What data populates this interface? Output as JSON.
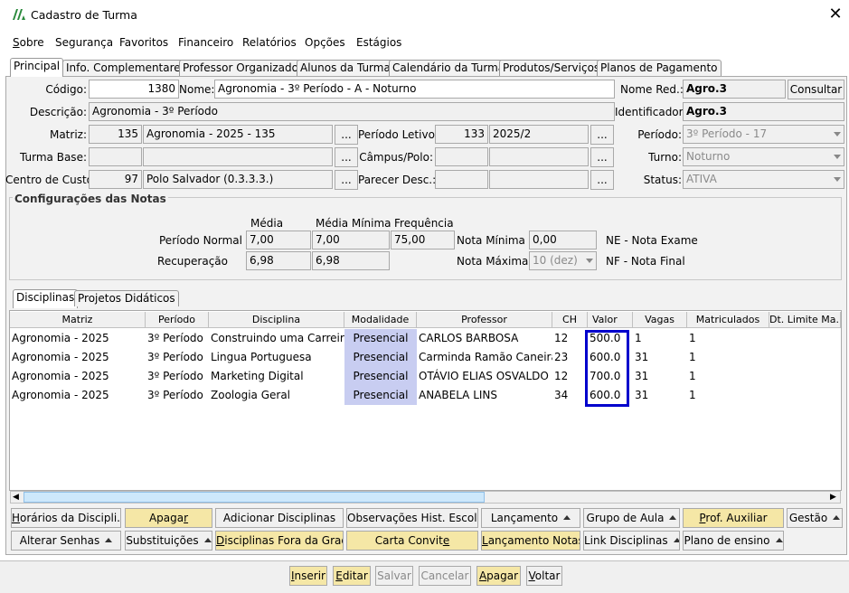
{
  "window": {
    "title": "Cadastro de Turma"
  },
  "menu": [
    "Sobre",
    "Segurança",
    "Favoritos",
    "Financeiro",
    "Relatórios",
    "Opções",
    "Estágios"
  ],
  "tabs": [
    "Principal",
    "Info. Complementares",
    "Professor Organizador",
    "Alunos da Turma",
    "Calendário da Turma",
    "Produtos/Serviços",
    "Planos de Pagamento"
  ],
  "form": {
    "codigo_label": "Código:",
    "codigo": "1380",
    "nome_label": "Nome:",
    "nome": "Agronomia - 3º Período - A - Noturno",
    "nome_red_label": "Nome Red.:",
    "nome_red": "Agro.3",
    "consultar": "Consultar",
    "descricao_label": "Descrição:",
    "descricao": "Agronomia - 3º Período",
    "identificador_label": "Identificador:",
    "identificador": "Agro.3",
    "matriz_label": "Matriz:",
    "matriz_cod": "135",
    "matriz_nome": "Agronomia - 2025 - 135",
    "periodo_letivo_label": "Período Letivo:",
    "periodo_letivo_cod": "133",
    "periodo_letivo": "2025/2",
    "periodo_label": "Período:",
    "periodo": "3º Período - 17",
    "turma_base_label": "Turma Base:",
    "campus_label": "Câmpus/Polo:",
    "turno_label": "Turno:",
    "turno": "Noturno",
    "centro_custo_label": "Centro de Custo:",
    "centro_custo_cod": "97",
    "centro_custo": "Polo Salvador (0.3.3.3.)",
    "parecer_label": "Parecer Desc.:",
    "status_label": "Status:",
    "status": "ATIVA",
    "ellipsis": "..."
  },
  "notas": {
    "group_title": "Configurações das Notas",
    "col_media": "Média",
    "col_media_minima": "Média Mínima",
    "col_frequencia": "Frequência",
    "periodo_normal_label": "Período Normal",
    "pn_media": "7,00",
    "pn_media_minima": "7,00",
    "pn_frequencia": "75,00",
    "recuperacao_label": "Recuperação",
    "rec_media": "6,98",
    "rec_media_minima": "6,98",
    "nota_minima_label": "Nota Mínima",
    "nota_minima": "0,00",
    "nota_maxima_label": "Nota Máxima",
    "nota_maxima": "10 (dez)",
    "ne_legend": "NE - Nota Exame",
    "nf_legend": "NF - Nota Final"
  },
  "subtabs": [
    "Disciplinas",
    "Projetos Didáticos"
  ],
  "grid": {
    "headers": [
      "Matriz",
      "Período",
      "Disciplina",
      "Modalidade",
      "Professor",
      "CH",
      "Valor",
      "Vagas",
      "Matriculados",
      "Dt. Limite Ma..."
    ],
    "rows": [
      [
        "Agronomia - 2025",
        "3º Período",
        "Construindo uma Carreira de",
        "Presencial",
        "CARLOS BARBOSA",
        "12",
        "500.0",
        "1",
        "1"
      ],
      [
        "Agronomia - 2025",
        "3º Período",
        "Lingua Portuguesa",
        "Presencial",
        "Carminda Ramão Caneira",
        "23",
        "600.0",
        "31",
        "1"
      ],
      [
        "Agronomia - 2025",
        "3º Período",
        "Marketing Digital",
        "Presencial",
        "OTÁVIO ELIAS OSVALDO ...",
        "12",
        "700.0",
        "31",
        "1"
      ],
      [
        "Agronomia - 2025",
        "3º Período",
        "Zoologia Geral",
        "Presencial",
        "ANABELA LINS",
        "34",
        "600.0",
        "31",
        "1"
      ]
    ]
  },
  "actions_row1": [
    "Horários da Discipli...",
    "Apagar",
    "Adicionar Disciplinas",
    "Observações Hist. Escolar",
    "Lançamento",
    "Grupo de Aula",
    "Prof. Auxiliar",
    "Gestão"
  ],
  "actions_row2": [
    "Alterar Senhas",
    "Substituições",
    "Disciplinas Fora da Grade",
    "Carta Convite",
    "Lançamento Notas",
    "Link Disciplinas",
    "Plano de ensino"
  ],
  "bottom": [
    "Inserir",
    "Editar",
    "Salvar",
    "Cancelar",
    "Apagar",
    "Voltar"
  ],
  "colors": {
    "highlight_border": "#0000cc",
    "modalidade_bg": "#c8cdf1",
    "yellow_button": "#f5e7a6"
  }
}
